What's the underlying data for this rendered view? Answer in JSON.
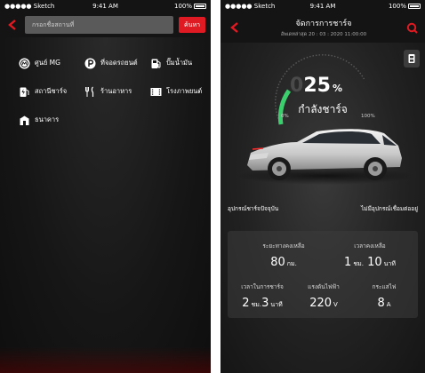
{
  "status_bar": {
    "carrier": "●●●●● Sketch",
    "time": "9:41 AM",
    "battery": "100%"
  },
  "left_screen": {
    "search_placeholder": "กรอกชื่อสถานที่",
    "search_button": "ค้นหา",
    "categories": [
      {
        "label": "ศูนย์ MG",
        "icon": "mg-logo-icon"
      },
      {
        "label": "ที่จอดรถยนต์",
        "icon": "parking-icon"
      },
      {
        "label": "ปั๊มน้ำมัน",
        "icon": "fuel-pump-icon"
      },
      {
        "label": "สถานีชาร์จ",
        "icon": "charging-station-icon"
      },
      {
        "label": "ร้านอาหาร",
        "icon": "utensils-icon"
      },
      {
        "label": "โรงภาพยนต์",
        "icon": "cinema-icon"
      },
      {
        "label": "ธนาคาร",
        "icon": "bank-icon"
      }
    ]
  },
  "right_screen": {
    "title": "จัดการการชาร์จ",
    "subtitle": "อัพเดทล่าสุด 20 : 03 : 2020 11:00:00",
    "battery_percent": "25",
    "percent_unit": "%",
    "charged_label": "กำลังชาร์จ",
    "gauge_min": "0%",
    "gauge_max": "100%",
    "device_label": "อุปกรณ์ชาร์จปัจจุบัน",
    "device_value": "ไม่มีอุปกรณ์เชื่อมต่ออยู่",
    "info": {
      "range_label": "ระยะทางคงเหลือ",
      "range_value": "80",
      "range_unit": "กม.",
      "time_left_label": "เวลาคงเหลือ",
      "time_left_value": "1",
      "time_left_unit1": "ชม.",
      "time_left_value2": "10",
      "time_left_unit2": "นาที",
      "charge_time_label": "เวลาในการชาร์จ",
      "charge_time_value": "2",
      "charge_time_unit1": "ชม.",
      "charge_time_value2": "3",
      "charge_time_unit2": "นาที",
      "voltage_label": "แรงดันไฟฟ้า",
      "voltage_value": "220",
      "voltage_unit": "V",
      "current_label": "กระแสไฟ",
      "current_value": "8",
      "current_unit": "A"
    }
  },
  "colors": {
    "accent": "#e01a22",
    "gauge_green": "#3ccf6e",
    "background": "#141414"
  }
}
